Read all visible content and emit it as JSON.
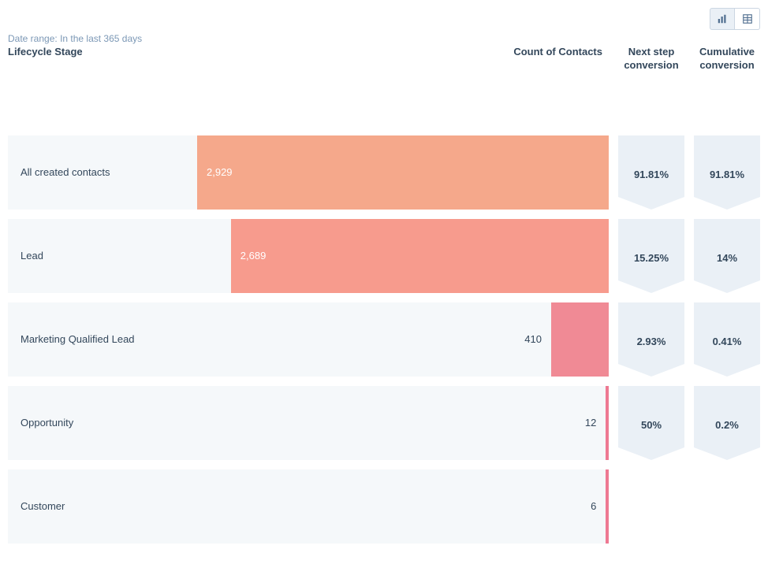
{
  "toolbar": {
    "chart_view": "chart",
    "table_view": "table"
  },
  "date_range": {
    "label": "Date range:",
    "value": "In the last 365 days"
  },
  "headers": {
    "stage": "Lifecycle Stage",
    "count": "Count of Contacts",
    "next": "Next step conversion",
    "cumulative": "Cumulative conversion"
  },
  "chart_data": {
    "type": "bar",
    "title": "Lifecycle Stage",
    "xlabel": "Count of Contacts",
    "max": 2929,
    "stages": [
      {
        "label": "All created contacts",
        "count": 2929,
        "count_fmt": "2,929",
        "next_step": "91.81%",
        "cumulative": "91.81%",
        "color": "#f5a88b",
        "text_inside": true
      },
      {
        "label": "Lead",
        "count": 2689,
        "count_fmt": "2,689",
        "next_step": "15.25%",
        "cumulative": "14%",
        "color": "#f79b8d",
        "text_inside": true
      },
      {
        "label": "Marketing Qualified Lead",
        "count": 410,
        "count_fmt": "410",
        "next_step": "2.93%",
        "cumulative": "0.41%",
        "color": "#f08a95",
        "text_inside": false
      },
      {
        "label": "Opportunity",
        "count": 12,
        "count_fmt": "12",
        "next_step": "50%",
        "cumulative": "0.2%",
        "color": "#ee7992",
        "text_inside": false
      },
      {
        "label": "Customer",
        "count": 6,
        "count_fmt": "6",
        "next_step": "",
        "cumulative": "",
        "color": "#ee7992",
        "text_inside": false
      }
    ]
  }
}
